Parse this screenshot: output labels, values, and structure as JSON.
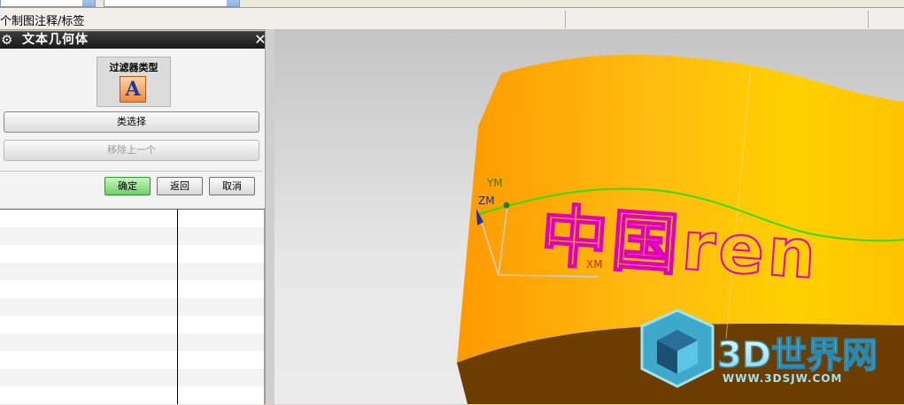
{
  "toolbar": {
    "combo1_value": "",
    "combo2_value": ""
  },
  "status": {
    "text": "个制图注释/标签"
  },
  "dialog": {
    "title": "文本几何体",
    "close_glyph": "✕",
    "gear_glyph": "⚙",
    "filter_label": "过滤器类型",
    "filter_button_glyph": "A",
    "class_select_label": "类选择",
    "remove_previous_label": "移除上一个",
    "ok_label": "确定",
    "back_label": "返回",
    "cancel_label": "取消"
  },
  "viewport": {
    "axis_labels": {
      "ym": "YM",
      "zm": "ZM",
      "xm": "XM"
    },
    "text_geometry": "中国ren",
    "watermark": {
      "title": "3D世界网",
      "url": "WWW.3DSJW.COM"
    },
    "colors": {
      "surface": "#ffb400",
      "text": "#e000c0",
      "curve": "#33dd00",
      "base": "#6b3e00"
    }
  }
}
